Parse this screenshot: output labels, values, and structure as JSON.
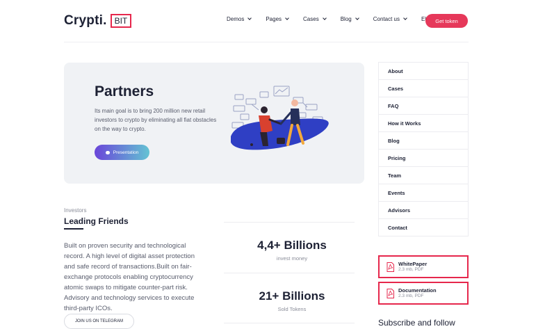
{
  "header": {
    "logo_text": "Crypti.",
    "logo_badge": "BIT",
    "nav": [
      "Demos",
      "Pages",
      "Cases",
      "Blog",
      "Contact us",
      "Elements"
    ],
    "cta": "Get token"
  },
  "hero": {
    "title": "Partners",
    "description": "Its main goal is to bring 200 million new retail investors to crypto by eliminating all fiat obstacles on the way to crypto.",
    "button": "Presentation"
  },
  "sidebar": {
    "items": [
      "About",
      "Cases",
      "FAQ",
      "How it Works",
      "Blog",
      "Pricing",
      "Team",
      "Events",
      "Advisors",
      "Contact"
    ],
    "downloads": [
      {
        "title": "WhitePaper",
        "meta": "2.3 mb, PDF"
      },
      {
        "title": "Documentation",
        "meta": "2.3 mb, PDF"
      }
    ],
    "subscribe": "Subscribe and follow"
  },
  "investors": {
    "label": "Investors",
    "title": "Leading Friends",
    "description": "Built on proven security and technological record. A high level of digital asset protection and safe record of transactions.Built on fair-exchange protocols enabling cryptocurrency atomic swaps to mitigate counter-part risk. Advisory and technology services to execute third-party ICOs.",
    "button": "JOIN US ON TELEGRAM"
  },
  "stats": [
    {
      "value": "4,4+ Billions",
      "label": "invest money"
    },
    {
      "value": "21+ Billions",
      "label": "Sold Tokens"
    }
  ],
  "colors": {
    "accent": "#e6274c",
    "text": "#1d2134",
    "muted": "#8a8d99",
    "hero_bg": "#f0f2f5",
    "button_gradient_start": "#6a46d9",
    "button_gradient_end": "#63c3d3"
  },
  "icons": {
    "pdf": "pdf-file-icon",
    "chat": "chat-bubble-icon",
    "chevron": "chevron-down-icon"
  }
}
